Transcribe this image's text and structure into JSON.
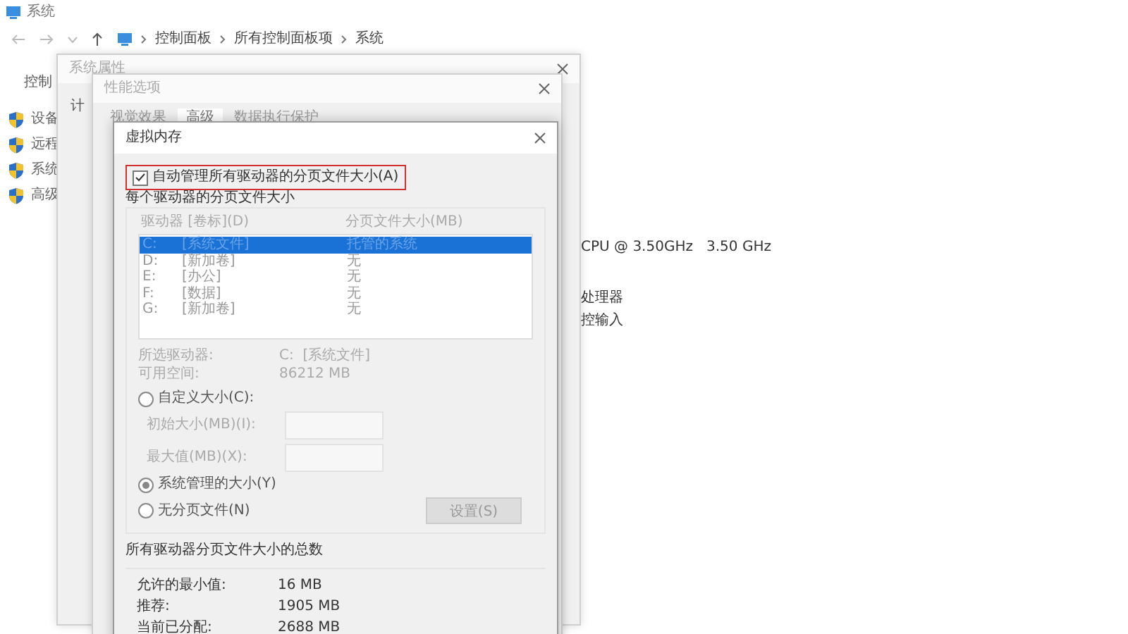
{
  "system_window": {
    "title": "系统",
    "breadcrumb": [
      "控制面板",
      "所有控制面板项",
      "系统"
    ],
    "nav_label": "控制",
    "sidebar_items": [
      {
        "label": "设备"
      },
      {
        "label": "远程"
      },
      {
        "label": "系统"
      },
      {
        "label": "高级"
      }
    ],
    "info_lines": [
      "CPU @ 3.50GHz   3.50 GHz",
      "处理器",
      "控输入"
    ]
  },
  "system_properties": {
    "title": "系统属性",
    "tab_fragment": "计"
  },
  "performance_options": {
    "title": "性能选项",
    "tabs": [
      {
        "label": "视觉效果",
        "selected": false
      },
      {
        "label": "高级",
        "selected": true
      },
      {
        "label": "数据执行保护",
        "selected": false
      }
    ]
  },
  "virtual_memory": {
    "title": "虚拟内存",
    "auto_manage": {
      "label": "自动管理所有驱动器的分页文件大小(A)",
      "checked": true,
      "highlighted": true
    },
    "group_title": "每个驱动器的分页文件大小",
    "columns": [
      "驱动器 [卷标](D)",
      "分页文件大小(MB)"
    ],
    "drives": [
      {
        "drive": "C:",
        "label": "[系统文件]",
        "size": "托管的系统",
        "selected": true
      },
      {
        "drive": "D:",
        "label": "[新加卷]",
        "size": "无",
        "selected": false
      },
      {
        "drive": "E:",
        "label": "[办公]",
        "size": "无",
        "selected": false
      },
      {
        "drive": "F:",
        "label": "[数据]",
        "size": "无",
        "selected": false
      },
      {
        "drive": "G:",
        "label": "[新加卷]",
        "size": "无",
        "selected": false
      }
    ],
    "selected_drive": {
      "label": "所选驱动器:",
      "value": "C:  [系统文件]"
    },
    "free_space": {
      "label": "可用空间:",
      "value": "86212 MB"
    },
    "options": [
      {
        "kind": "radio",
        "label": "自定义大小(C):",
        "selected": false
      },
      {
        "kind": "field",
        "label": "初始大小(MB)(I):"
      },
      {
        "kind": "field",
        "label": "最大值(MB)(X):"
      },
      {
        "kind": "radio",
        "label": "系统管理的大小(Y)",
        "selected": true
      },
      {
        "kind": "radio",
        "label": "无分页文件(N)",
        "selected": false
      }
    ],
    "set_button": {
      "label": "设置(S)",
      "disabled": true
    },
    "totals_title": "所有驱动器分页文件大小的总数",
    "totals": [
      {
        "label": "允许的最小值:",
        "value": "16 MB"
      },
      {
        "label": "推荐:",
        "value": "1905 MB"
      },
      {
        "label": "当前已分配:",
        "value": "2688 MB"
      }
    ]
  }
}
